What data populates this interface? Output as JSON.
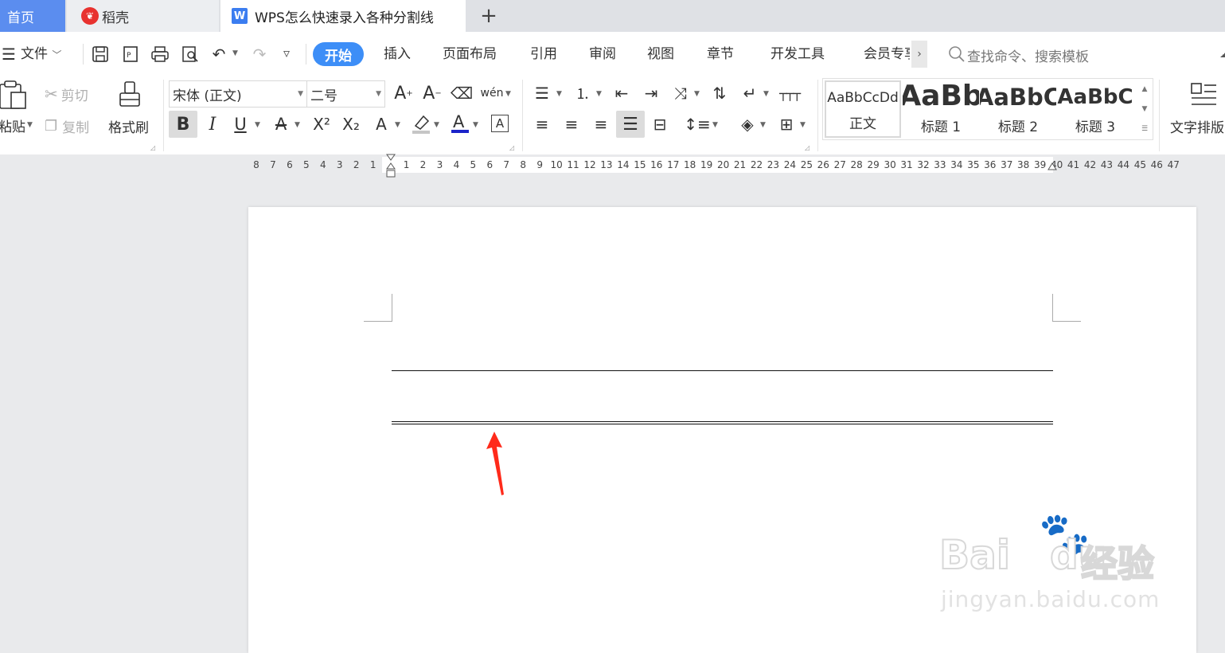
{
  "tabs": {
    "home": "首页",
    "docer": "稻壳",
    "document": "WPS怎么快速录入各种分割线",
    "add": "+"
  },
  "menu": {
    "file": "文件",
    "start": "开始",
    "items": [
      "插入",
      "页面布局",
      "引用",
      "审阅",
      "视图",
      "章节",
      "开发工具",
      "会员专享"
    ],
    "search_placeholder": "查找命令、搜索模板"
  },
  "ribbon": {
    "paste": "粘贴",
    "cut": "剪切",
    "copy": "复制",
    "format_painter": "格式刷",
    "font_name": "宋体 (正文)",
    "font_size": "二号",
    "styles": [
      {
        "preview": "AaBbCcDd",
        "name": "正文"
      },
      {
        "preview": "AaBb",
        "name": "标题 1"
      },
      {
        "preview": "AaBbC",
        "name": "标题 2"
      },
      {
        "preview": "AaBbC",
        "name": "标题 3"
      }
    ],
    "text_layout": "文字排版"
  },
  "ruler": {
    "numbers": [
      "8",
      "7",
      "6",
      "5",
      "4",
      "3",
      "2",
      "1",
      "",
      "1",
      "2",
      "3",
      "4",
      "5",
      "6",
      "7",
      "8",
      "9",
      "10",
      "11",
      "12",
      "13",
      "14",
      "15",
      "16",
      "17",
      "18",
      "19",
      "20",
      "21",
      "22",
      "23",
      "24",
      "25",
      "26",
      "27",
      "28",
      "29",
      "30",
      "31",
      "32",
      "33",
      "34",
      "35",
      "36",
      "37",
      "38",
      "39",
      "40",
      "41",
      "42",
      "43",
      "44",
      "45",
      "46",
      "47"
    ]
  },
  "watermark": {
    "brand": "Bai",
    "brand2": "du",
    "cn": "经验",
    "url": "jingyan.baidu.com"
  },
  "colors": {
    "accent": "#3d8ef7",
    "home_tab": "#5b8def",
    "annotation_arrow": "#ff2a1a"
  }
}
